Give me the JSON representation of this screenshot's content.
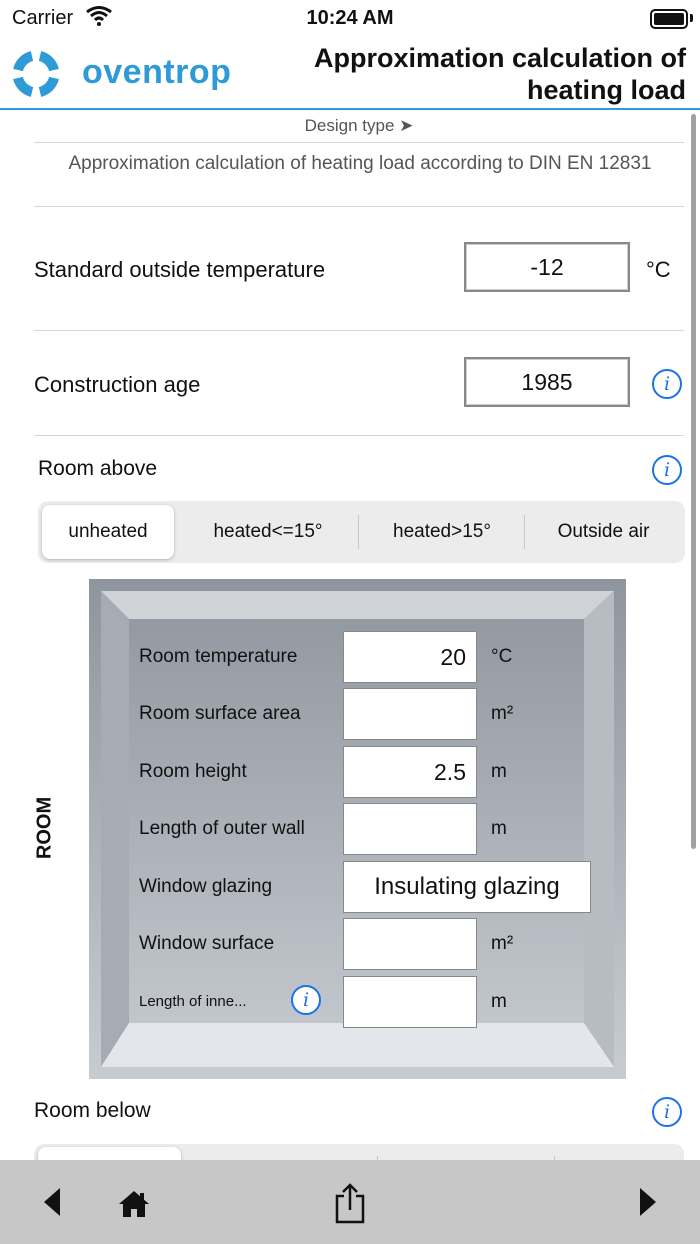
{
  "status": {
    "carrier": "Carrier",
    "time": "10:24 AM"
  },
  "header": {
    "logo_text": "oventrop",
    "title": "Approximation calculation of heating load"
  },
  "design_type": "Design type ➤",
  "standard_text": "Approximation calculation of heating load according to DIN EN 12831",
  "outside_temp": {
    "label": "Standard outside temperature",
    "value": "-12",
    "unit": "°C"
  },
  "construction_age": {
    "label": "Construction age",
    "value": "1985"
  },
  "room_above": {
    "label": "Room above",
    "options": [
      "unheated",
      "heated<=15°",
      "heated>15°",
      "Outside air"
    ],
    "selected": "unheated"
  },
  "room": {
    "side_label": "ROOM",
    "fields": [
      {
        "label": "Room temperature",
        "value": "20",
        "unit": "°C"
      },
      {
        "label": "Room surface area",
        "value": "",
        "unit": "m²"
      },
      {
        "label": "Room height",
        "value": "2.5",
        "unit": "m"
      },
      {
        "label": "Length of outer wall",
        "value": "",
        "unit": "m"
      },
      {
        "label": "Window glazing",
        "value": "Insulating glazing",
        "unit": ""
      },
      {
        "label": "Window surface",
        "value": "",
        "unit": "m²"
      },
      {
        "label": "Length of inne...",
        "value": "",
        "unit": "m"
      }
    ]
  },
  "room_below": {
    "label": "Room below"
  },
  "colors": {
    "accent": "#2f9bd6",
    "info_blue": "#1a73e8",
    "toolbar": "#c7c7c7"
  },
  "icons": [
    "wifi-icon",
    "battery-icon",
    "info-icon",
    "back-arrow-icon",
    "home-icon",
    "share-icon",
    "forward-arrow-icon"
  ]
}
